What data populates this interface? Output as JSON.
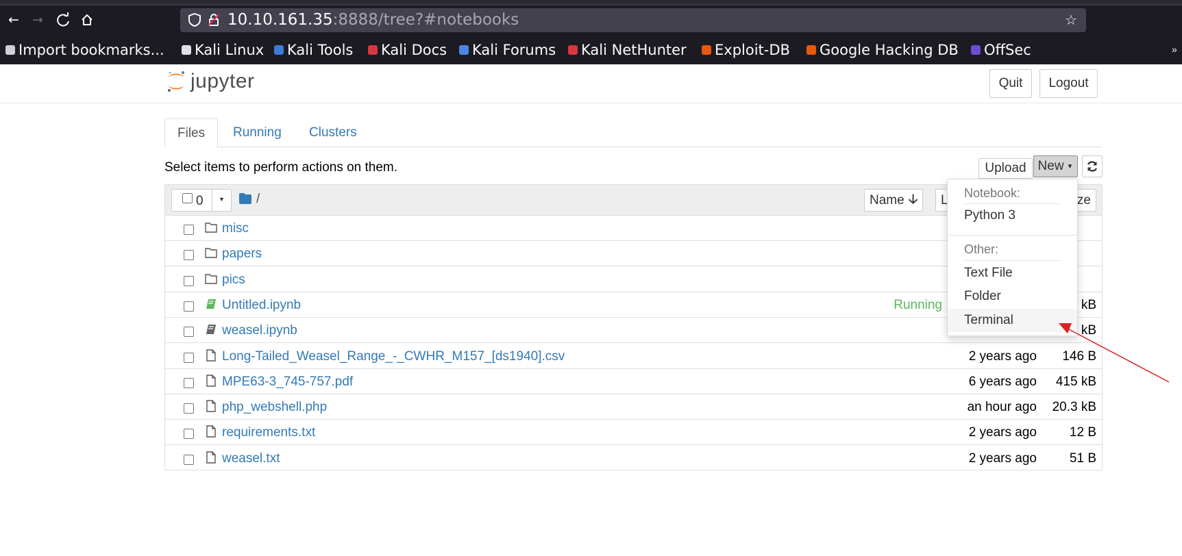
{
  "browser": {
    "url_host": "10.10.161.35",
    "url_rest": ":8888/tree?#notebooks",
    "bookmarks": [
      {
        "label": "Import bookmarks...",
        "color": "#cfcfd8"
      },
      {
        "label": "Kali Linux",
        "color": "#e0e0e6"
      },
      {
        "label": "Kali Tools",
        "color": "#3d7bd9"
      },
      {
        "label": "Kali Docs",
        "color": "#d9363e"
      },
      {
        "label": "Kali Forums",
        "color": "#4a86e8"
      },
      {
        "label": "Kali NetHunter",
        "color": "#d9363e"
      },
      {
        "label": "Exploit-DB",
        "color": "#e8590c"
      },
      {
        "label": "Google Hacking DB",
        "color": "#e8590c"
      },
      {
        "label": "OffSec",
        "color": "#6f4bd8"
      }
    ]
  },
  "header": {
    "logo_text": "jupyter",
    "quit_label": "Quit",
    "logout_label": "Logout"
  },
  "tabs": [
    {
      "label": "Files",
      "active": true
    },
    {
      "label": "Running",
      "active": false
    },
    {
      "label": "Clusters",
      "active": false
    }
  ],
  "toolbar": {
    "hint": "Select items to perform actions on them.",
    "upload_label": "Upload",
    "new_label": "New"
  },
  "list_header": {
    "selected_count": "0",
    "breadcrumb": "/",
    "sort_name_label": "Name",
    "sort_modified_label": "La",
    "sort_size_label": "ze"
  },
  "files": [
    {
      "name": "misc",
      "type": "folder",
      "status": "",
      "modified": "",
      "size": ""
    },
    {
      "name": "papers",
      "type": "folder",
      "status": "",
      "modified": "",
      "size": ""
    },
    {
      "name": "pics",
      "type": "folder",
      "status": "",
      "modified": "",
      "size": ""
    },
    {
      "name": "Untitled.ipynb",
      "type": "notebook-running",
      "status": "Running",
      "modified": "",
      "size": "kB"
    },
    {
      "name": "weasel.ipynb",
      "type": "notebook",
      "status": "",
      "modified": "",
      "size": "kB"
    },
    {
      "name": "Long-Tailed_Weasel_Range_-_CWHR_M157_[ds1940].csv",
      "type": "file",
      "status": "",
      "modified": "2 years ago",
      "size": "146 B"
    },
    {
      "name": "MPE63-3_745-757.pdf",
      "type": "file",
      "status": "",
      "modified": "6 years ago",
      "size": "415 kB"
    },
    {
      "name": "php_webshell.php",
      "type": "file",
      "status": "",
      "modified": "an hour ago",
      "size": "20.3 kB"
    },
    {
      "name": "requirements.txt",
      "type": "file",
      "status": "",
      "modified": "2 years ago",
      "size": "12 B"
    },
    {
      "name": "weasel.txt",
      "type": "file",
      "status": "",
      "modified": "2 years ago",
      "size": "51 B"
    }
  ],
  "new_menu": {
    "notebook_header": "Notebook:",
    "python_label": "Python 3",
    "other_header": "Other:",
    "text_file_label": "Text File",
    "folder_label": "Folder",
    "terminal_label": "Terminal"
  },
  "colors": {
    "link": "#337ab7",
    "running": "#5cb85c",
    "jupyter_orange": "#f37726",
    "annotation_arrow": "#e02020"
  }
}
